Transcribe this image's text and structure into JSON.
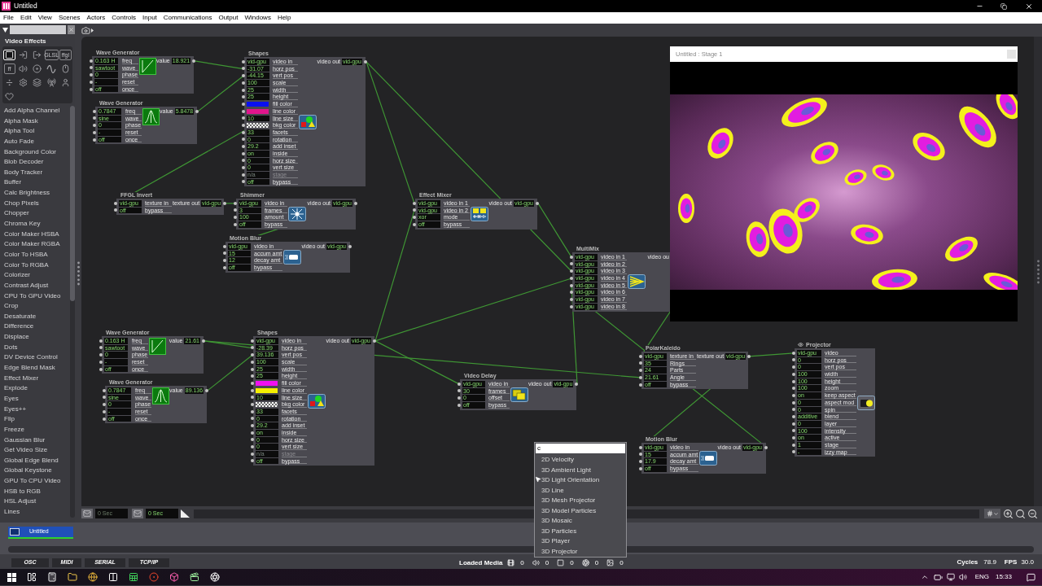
{
  "window": {
    "title": "Untitled"
  },
  "menu": [
    "File",
    "Edit",
    "View",
    "Scenes",
    "Actors",
    "Controls",
    "Input",
    "Communications",
    "Output",
    "Windows",
    "Help"
  ],
  "library": {
    "heading": "Video Effects",
    "categories": [
      {
        "selected": true
      },
      {
        "selected": false
      },
      {
        "selected": false
      },
      {
        "label": "GLSL",
        "selected": false
      },
      {
        "label": "ffgl",
        "selected": false
      },
      {
        "label": "ff",
        "selected": false
      },
      {
        "selected": false
      },
      {
        "selected": false
      },
      {
        "selected": false
      },
      {
        "selected": false
      },
      {
        "selected": false
      },
      {
        "selected": false
      },
      {
        "selected": false
      },
      {
        "selected": false
      },
      {
        "selected": false
      },
      {
        "selected": false
      }
    ],
    "items": [
      "Add Alpha Channel",
      "Alpha Mask",
      "Alpha Tool",
      "Auto Fade",
      "Background Color",
      "Blob Decoder",
      "Body Tracker",
      "Buffer",
      "Calc Brightness",
      "Chop Pixels",
      "Chopper",
      "Chroma Key",
      "Color Maker HSBA",
      "Color Maker RGBA",
      "Color To HSBA",
      "Color To RGBA",
      "Colorizer",
      "Contrast Adjust",
      "CPU To GPU Video",
      "Crop",
      "Desaturate",
      "Difference",
      "Displace",
      "Dots",
      "DV Device Control",
      "Edge Blend Mask",
      "Effect Mixer",
      "Explode",
      "Eyes",
      "Eyes++",
      "Flip",
      "Freeze",
      "Gaussian Blur",
      "Get Video Size",
      "Global Edge Blend",
      "Global Keystone",
      "GPU To CPU Video",
      "HSB to RGB",
      "HSL Adjust",
      "Lines"
    ]
  },
  "canvas": {
    "nodes": [
      {
        "title": "Wave Generator",
        "kind": "wave_saw",
        "inputs": [
          {
            "kind": "value",
            "value": "0.163 H",
            "label": "freq"
          },
          {
            "kind": "value",
            "value": "sawtoot",
            "label": "wave"
          },
          {
            "kind": "value",
            "value": "0",
            "label": "phase"
          },
          {
            "kind": "value",
            "value": "-",
            "label": "reset"
          },
          {
            "kind": "value",
            "value": "off",
            "label": "once"
          }
        ],
        "outputs": [
          {
            "label": "value",
            "value": "18.921"
          }
        ]
      },
      {
        "title": "Wave Generator",
        "kind": "wave_sine",
        "inputs": [
          {
            "kind": "value",
            "value": "0.7847",
            "label": "freq"
          },
          {
            "kind": "value",
            "value": "sine",
            "label": "wave"
          },
          {
            "kind": "value",
            "value": "0",
            "label": "phase"
          },
          {
            "kind": "value",
            "value": "-",
            "label": "reset"
          },
          {
            "kind": "value",
            "value": "off",
            "label": "once"
          }
        ],
        "outputs": [
          {
            "label": "value",
            "value": "5.8478"
          }
        ]
      },
      {
        "title": "Shapes",
        "kind": "shapes",
        "inputs": [
          {
            "kind": "value",
            "value": "vid-gpu",
            "label": "video in"
          },
          {
            "kind": "value",
            "value": "-31.07",
            "label": "horz pos"
          },
          {
            "kind": "value",
            "value": "-44.15",
            "label": "vert pos"
          },
          {
            "kind": "value",
            "value": "100",
            "label": "scale"
          },
          {
            "kind": "value",
            "value": "25",
            "label": "width"
          },
          {
            "kind": "value",
            "value": "25",
            "label": "height"
          },
          {
            "kind": "color",
            "color": "#0a10f0",
            "label": "fill color"
          },
          {
            "kind": "color",
            "color": "#e0158c",
            "label": "line color"
          },
          {
            "kind": "value",
            "value": "10",
            "label": "line size"
          },
          {
            "kind": "checker",
            "label": "bkg color"
          },
          {
            "kind": "value",
            "value": "33",
            "label": "facets"
          },
          {
            "kind": "value",
            "value": "0",
            "label": "rotation"
          },
          {
            "kind": "value",
            "value": "29.2",
            "label": "add inset"
          },
          {
            "kind": "value",
            "value": "on",
            "label": "inside"
          },
          {
            "kind": "value",
            "value": "0",
            "label": "horz size"
          },
          {
            "kind": "value",
            "value": "0",
            "label": "vert size"
          },
          {
            "kind": "inactive",
            "value": "n/a",
            "label": "stage"
          },
          {
            "kind": "value",
            "value": "off",
            "label": "bypass"
          }
        ],
        "outputs": [
          {
            "label": "video out",
            "value": "vid-gpu"
          }
        ]
      },
      {
        "title": "FFGL Invert",
        "kind": "ffgl",
        "inputs": [
          {
            "kind": "value",
            "value": "vid-gpu",
            "label": "texture in"
          },
          {
            "kind": "value",
            "value": "off",
            "label": "bypass"
          }
        ],
        "outputs": [
          {
            "label": "texture out",
            "value": "vid-gpu"
          }
        ]
      },
      {
        "title": "Shimmer",
        "kind": "shimmer",
        "inputs": [
          {
            "kind": "value",
            "value": "vid-gpu",
            "label": "video in"
          },
          {
            "kind": "value",
            "value": "3",
            "label": "frames"
          },
          {
            "kind": "value",
            "value": "100",
            "label": "amount"
          },
          {
            "kind": "value",
            "value": "off",
            "label": "bypass"
          }
        ],
        "outputs": [
          {
            "label": "video out",
            "value": "vid-gpu"
          }
        ]
      },
      {
        "title": "Motion Blur",
        "kind": "motion_blur",
        "inputs": [
          {
            "kind": "value",
            "value": "vid-gpu",
            "label": "video in"
          },
          {
            "kind": "value",
            "value": "15",
            "label": "accum amt"
          },
          {
            "kind": "value",
            "value": "12",
            "label": "decay amt"
          },
          {
            "kind": "value",
            "value": "off",
            "label": "bypass"
          }
        ],
        "outputs": [
          {
            "label": "video out",
            "value": "vid-gpu"
          }
        ]
      },
      {
        "title": "Effect Mixer",
        "kind": "effect_mixer",
        "inputs": [
          {
            "kind": "value",
            "value": "vid-gpu",
            "label": "video in 1"
          },
          {
            "kind": "value",
            "value": "vid-gpu",
            "label": "video in 2"
          },
          {
            "kind": "value",
            "value": "xor",
            "label": "mode"
          },
          {
            "kind": "value",
            "value": "off",
            "label": "bypass"
          }
        ],
        "outputs": [
          {
            "label": "video out",
            "value": "vid-gpu"
          }
        ]
      },
      {
        "title": "MultiMix",
        "kind": "multimix",
        "inputs": [
          {
            "kind": "value",
            "value": "vid-gpu",
            "label": "video in 1"
          },
          {
            "kind": "value",
            "value": "vid-gpu",
            "label": "video in 2"
          },
          {
            "kind": "value",
            "value": "vid-gpu",
            "label": "video in 3"
          },
          {
            "kind": "value",
            "value": "vid-gpu",
            "label": "video in 4"
          },
          {
            "kind": "value",
            "value": "vid-gpu",
            "label": "video in 5"
          },
          {
            "kind": "value",
            "value": "vid-gpu",
            "label": "video in 6"
          },
          {
            "kind": "value",
            "value": "vid-gpu",
            "label": "video in 7"
          },
          {
            "kind": "value",
            "value": "vid-gpu",
            "label": "video in 8"
          }
        ],
        "outputs": [
          {
            "label": "video ou"
          }
        ]
      },
      {
        "title": "Wave Generator",
        "kind": "wave_saw",
        "inputs": [
          {
            "kind": "value",
            "value": "0.163 H",
            "label": "freq"
          },
          {
            "kind": "value",
            "value": "sawtoot",
            "label": "wave"
          },
          {
            "kind": "value",
            "value": "0",
            "label": "phase"
          },
          {
            "kind": "value",
            "value": "-",
            "label": "reset"
          },
          {
            "kind": "value",
            "value": "off",
            "label": "once"
          }
        ],
        "outputs": [
          {
            "label": "value",
            "value": "21.61"
          }
        ]
      },
      {
        "title": "Wave Generator",
        "kind": "wave_sine",
        "inputs": [
          {
            "kind": "value",
            "value": "0.7847",
            "label": "freq"
          },
          {
            "kind": "value",
            "value": "sine",
            "label": "wave"
          },
          {
            "kind": "value",
            "value": "0",
            "label": "phase"
          },
          {
            "kind": "value",
            "value": "-",
            "label": "reset"
          },
          {
            "kind": "value",
            "value": "off",
            "label": "once"
          }
        ],
        "outputs": [
          {
            "label": "value",
            "value": "89.136"
          }
        ]
      },
      {
        "title": "Shapes",
        "kind": "shapes",
        "inputs": [
          {
            "kind": "value",
            "value": "vid-gpu",
            "label": "video in"
          },
          {
            "kind": "value",
            "value": "-28.39",
            "label": "horz pos"
          },
          {
            "kind": "value",
            "value": "39.136",
            "label": "vert pos"
          },
          {
            "kind": "value",
            "value": "100",
            "label": "scale"
          },
          {
            "kind": "value",
            "value": "25",
            "label": "width"
          },
          {
            "kind": "value",
            "value": "25",
            "label": "height"
          },
          {
            "kind": "color",
            "color": "#f010f0",
            "label": "fill color"
          },
          {
            "kind": "color",
            "color": "#f5f000",
            "label": "line color"
          },
          {
            "kind": "value",
            "value": "10",
            "label": "line size"
          },
          {
            "kind": "checker",
            "label": "bkg color"
          },
          {
            "kind": "value",
            "value": "33",
            "label": "facets"
          },
          {
            "kind": "value",
            "value": "0",
            "label": "rotation"
          },
          {
            "kind": "value",
            "value": "29.2",
            "label": "add inset"
          },
          {
            "kind": "value",
            "value": "on",
            "label": "inside"
          },
          {
            "kind": "value",
            "value": "0",
            "label": "horz size"
          },
          {
            "kind": "value",
            "value": "0",
            "label": "vert size"
          },
          {
            "kind": "inactive",
            "value": "n/a",
            "label": "stage"
          },
          {
            "kind": "value",
            "value": "off",
            "label": "bypass"
          }
        ],
        "outputs": [
          {
            "label": "video out",
            "value": "vid-gpu"
          }
        ]
      },
      {
        "title": "Video Delay",
        "kind": "video_delay",
        "inputs": [
          {
            "kind": "value",
            "value": "vid-gpu",
            "label": "video in"
          },
          {
            "kind": "value",
            "value": "30",
            "label": "frames"
          },
          {
            "kind": "value",
            "value": "0",
            "label": "offset"
          },
          {
            "kind": "value",
            "value": "off",
            "label": "bypass"
          }
        ],
        "outputs": [
          {
            "label": "video out",
            "value": "vid-gpu"
          }
        ]
      },
      {
        "title": "PolarKaleido",
        "kind": "kaleido",
        "inputs": [
          {
            "kind": "value",
            "value": "vid-gpu",
            "label": "texture in"
          },
          {
            "kind": "value",
            "value": "35",
            "label": "Rings"
          },
          {
            "kind": "value",
            "value": "24",
            "label": "Parts"
          },
          {
            "kind": "value",
            "value": "21.61",
            "label": "Angle"
          },
          {
            "kind": "value",
            "value": "off",
            "label": "bypass"
          }
        ],
        "outputs": [
          {
            "label": "texture out",
            "value": "vid-gpu"
          }
        ]
      },
      {
        "title": "Projector",
        "kind": "projector",
        "inputs": [
          {
            "kind": "value",
            "value": "vid-gpu",
            "label": "video"
          },
          {
            "kind": "value",
            "value": "0",
            "label": "horz pos"
          },
          {
            "kind": "value",
            "value": "0",
            "label": "vert pos"
          },
          {
            "kind": "value",
            "value": "100",
            "label": "width"
          },
          {
            "kind": "value",
            "value": "100",
            "label": "height"
          },
          {
            "kind": "value",
            "value": "100",
            "label": "zoom"
          },
          {
            "kind": "value",
            "value": "on",
            "label": "keep aspect"
          },
          {
            "kind": "value",
            "value": "0",
            "label": "aspect mod"
          },
          {
            "kind": "value",
            "value": "0",
            "label": "spin"
          },
          {
            "kind": "value",
            "value": "additive",
            "label": "blend"
          },
          {
            "kind": "value",
            "value": "0",
            "label": "layer"
          },
          {
            "kind": "value",
            "value": "100",
            "label": "intensity"
          },
          {
            "kind": "value",
            "value": "on",
            "label": "active"
          },
          {
            "kind": "value",
            "value": "1",
            "label": "stage"
          },
          {
            "kind": "value",
            "value": "-",
            "label": "izzy map"
          }
        ]
      },
      {
        "title": "Motion Blur",
        "kind": "motion_blur",
        "inputs": [
          {
            "kind": "value",
            "value": "vid-gpu",
            "label": "video in"
          },
          {
            "kind": "value",
            "value": "15",
            "label": "accum amt"
          },
          {
            "kind": "value",
            "value": "17.9",
            "label": "decay amt"
          },
          {
            "kind": "value",
            "value": "off",
            "label": "bypass"
          }
        ],
        "outputs": [
          {
            "label": "video out",
            "value": "vid-gpu"
          }
        ]
      }
    ]
  },
  "stage": {
    "title": "Untitled : Stage 1"
  },
  "timeline": {
    "fields": [
      {
        "value": "0 Sec",
        "disabled": true
      },
      {
        "value": "0 Sec",
        "disabled": false
      }
    ]
  },
  "scenes": [
    {
      "label": "Untitled",
      "selected": true
    }
  ],
  "status": {
    "ports": [
      "OSC",
      "MIDI",
      "SERIAL",
      "TCP/IP"
    ],
    "media_label": "Loaded Media",
    "media_counts": [
      "0",
      "0",
      "0",
      "0",
      "0"
    ],
    "cycles_label": "Cycles",
    "cycles": "78.9",
    "fps_label": "FPS",
    "fps": "30.0"
  },
  "popup": {
    "query": "c",
    "items": [
      "2D Velocity",
      "3D Ambient Light",
      "3D Light Orientation",
      "3D Line",
      "3D Mesh Projector",
      "3D Model Particles",
      "3D Mosaic",
      "3D Particles",
      "3D Player",
      "3D Projector"
    ]
  },
  "taskbar": {
    "language": "ENG",
    "time": "15:33"
  }
}
